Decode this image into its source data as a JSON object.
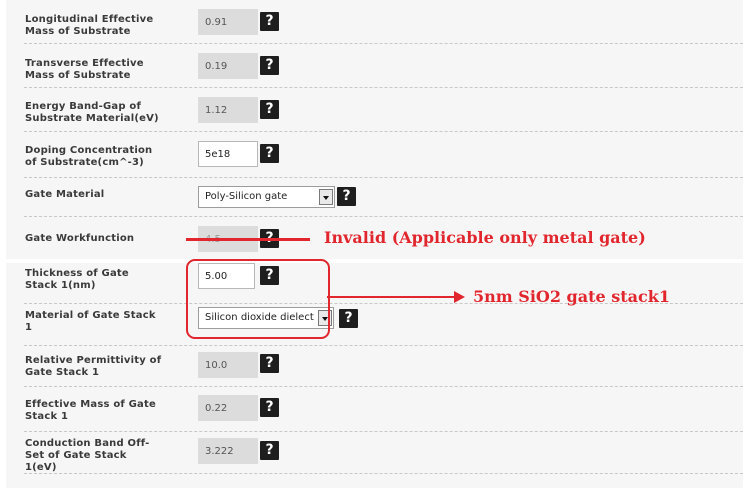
{
  "rows": [
    {
      "label_1": "Longitudinal Effective",
      "label_2": "Mass of Substrate",
      "value": "0.91"
    },
    {
      "label_1": "Transverse Effective",
      "label_2": "Mass of Substrate",
      "value": "0.19"
    },
    {
      "label_1": "Energy Band-Gap of",
      "label_2": "Substrate Material(eV)",
      "value": "1.12"
    },
    {
      "label_1": "Doping Concentration",
      "label_2": "of Substrate(cm^-3)",
      "value": "5e18"
    },
    {
      "label_1": "Gate Material",
      "selected": "Poly-Silicon gate"
    },
    {
      "label_1": "Gate Workfunction",
      "value": "4.5"
    },
    {
      "label_1": "Thickness of Gate",
      "label_2": "Stack 1(nm)",
      "value": "5.00"
    },
    {
      "label_1": "Material of Gate Stack",
      "label_2": "1",
      "selected": "Silicon dioxide dielect"
    },
    {
      "label_1": "Relative Permittivity of",
      "label_2": "Gate Stack 1",
      "value": "10.0"
    },
    {
      "label_1": "Effective Mass of Gate",
      "label_2": "Stack 1",
      "value": "0.22"
    },
    {
      "label_1": "Conduction Band Off-",
      "label_2": "Set of Gate Stack",
      "label_3": "1(eV)",
      "value": "3.222"
    }
  ],
  "help_glyph": "?",
  "annotations": {
    "invalid": "Invalid (Applicable only metal gate)",
    "stack": "5nm SiO2 gate stack1",
    "color": "#e2262e"
  },
  "icons": {
    "help": "question-mark-icon",
    "dropdown": "chevron-down-icon"
  }
}
